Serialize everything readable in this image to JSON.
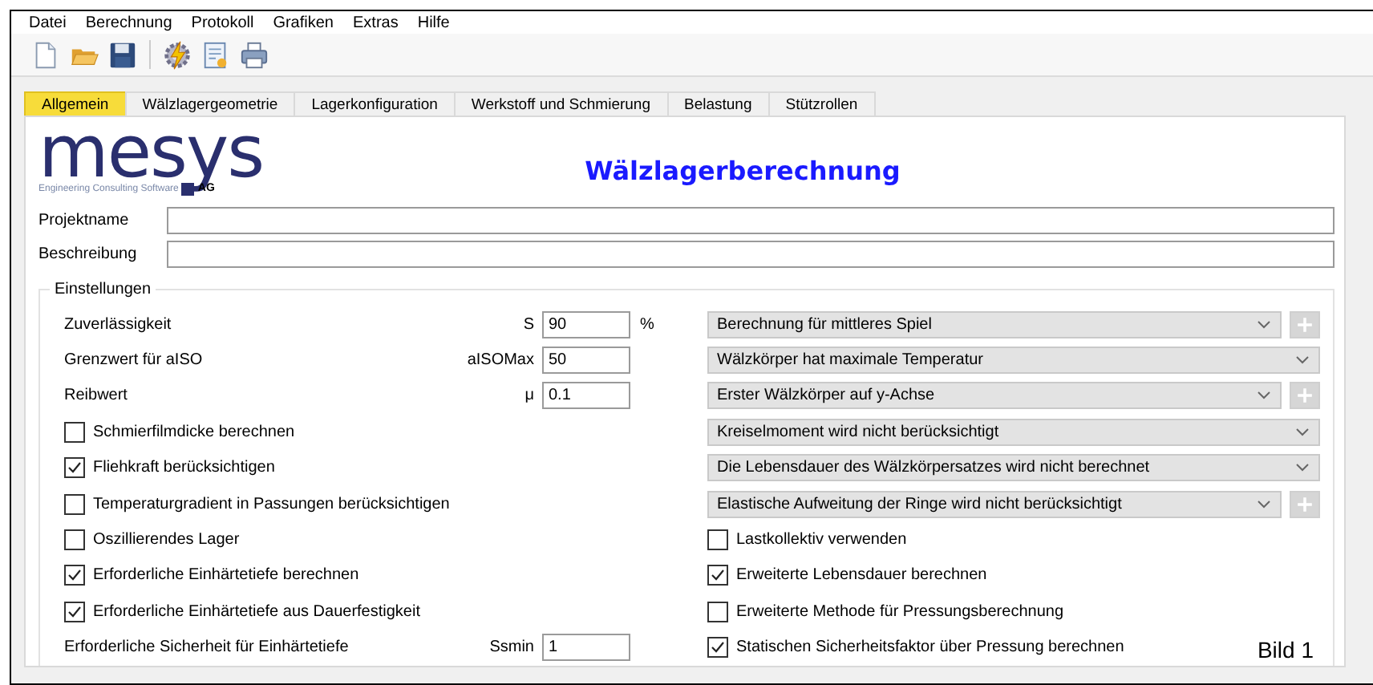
{
  "menu": [
    "Datei",
    "Berechnung",
    "Protokoll",
    "Grafiken",
    "Extras",
    "Hilfe"
  ],
  "tabs": [
    {
      "label": "Allgemein",
      "selected": true
    },
    {
      "label": "Wälzlagergeometrie",
      "selected": false
    },
    {
      "label": "Lagerkonfiguration",
      "selected": false
    },
    {
      "label": "Werkstoff und Schmierung",
      "selected": false
    },
    {
      "label": "Belastung",
      "selected": false
    },
    {
      "label": "Stützrollen",
      "selected": false
    }
  ],
  "logo": {
    "name": "mesys",
    "tagline": "Engineering Consulting Software",
    "suffix": "AG"
  },
  "title": "Wälzlagerberechnung",
  "fields": [
    {
      "label": "Projektname"
    },
    {
      "label": "Beschreibung"
    }
  ],
  "settings": {
    "title": "Einstellungen",
    "left": [
      {
        "kind": "param",
        "label": "Zuverlässigkeit",
        "symbol": "S",
        "value": "90",
        "unit": "%"
      },
      {
        "kind": "param",
        "label": "Grenzwert für aISO",
        "symbol": "aISOMax",
        "value": "50"
      },
      {
        "kind": "param",
        "label": "Reibwert",
        "symbol": "μ",
        "value": "0.1"
      },
      {
        "kind": "checkbox",
        "label": "Schmierfilmdicke berechnen",
        "checked": false
      },
      {
        "kind": "checkbox",
        "label": "Fliehkraft berücksichtigen",
        "checked": true
      },
      {
        "kind": "checkbox",
        "label": "Temperaturgradient in Passungen berücksichtigen",
        "checked": false
      },
      {
        "kind": "checkbox",
        "label": "Oszillierendes Lager",
        "checked": false
      },
      {
        "kind": "checkbox",
        "label": "Erforderliche Einhärtetiefe berechnen",
        "checked": true
      },
      {
        "kind": "checkbox",
        "label": "Erforderliche Einhärtetiefe aus Dauerfestigkeit",
        "checked": true
      },
      {
        "kind": "param",
        "label": "Erforderliche Sicherheit für Einhärtetiefe",
        "symbol": "Ssmin",
        "value": "1"
      }
    ],
    "right": [
      {
        "kind": "combo",
        "value": "Berechnung für mittleres Spiel",
        "add_button": true
      },
      {
        "kind": "combo",
        "value": "Wälzkörper hat maximale Temperatur",
        "add_button": false
      },
      {
        "kind": "combo",
        "value": "Erster Wälzkörper auf y-Achse",
        "add_button": true
      },
      {
        "kind": "combo",
        "value": "Kreiselmoment wird nicht berücksichtigt",
        "add_button": false
      },
      {
        "kind": "combo",
        "value": "Die Lebensdauer des Wälzkörpersatzes wird nicht berechnet",
        "add_button": false
      },
      {
        "kind": "combo",
        "value": "Elastische Aufweitung der Ringe wird nicht berücksichtigt",
        "add_button": true
      },
      {
        "kind": "checkbox",
        "label": "Lastkollektiv verwenden",
        "checked": false
      },
      {
        "kind": "checkbox",
        "label": "Erweiterte Lebensdauer berechnen",
        "checked": true
      },
      {
        "kind": "checkbox",
        "label": "Erweiterte Methode für Pressungsberechnung",
        "checked": false
      },
      {
        "kind": "checkbox",
        "label": "Statischen Sicherheitsfaktor über Pressung berechnen",
        "checked": true
      }
    ]
  },
  "caption": "Bild 1"
}
